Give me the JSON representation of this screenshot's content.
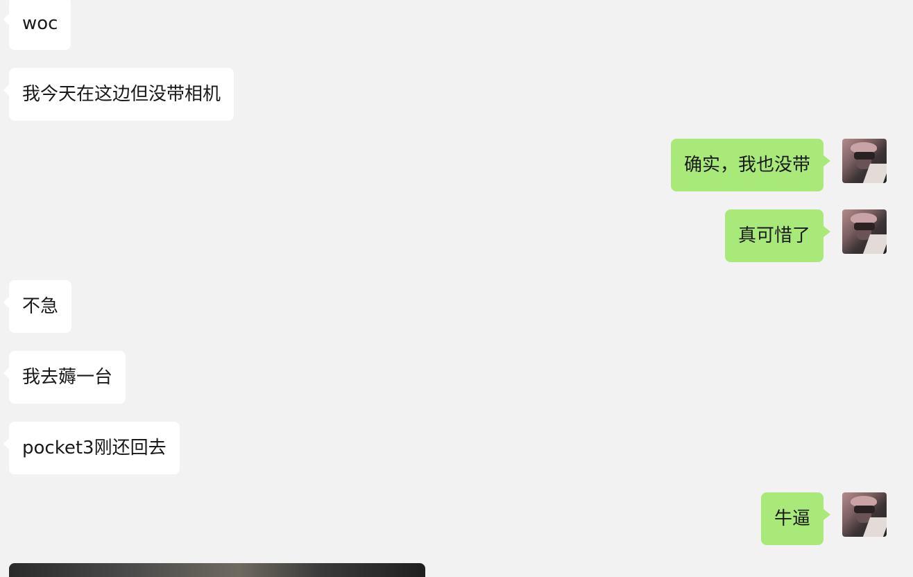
{
  "messages": [
    {
      "side": "in",
      "text": "woc"
    },
    {
      "side": "in",
      "text": "我今天在这边但没带相机"
    },
    {
      "side": "out",
      "text": "确实，我也没带"
    },
    {
      "side": "out",
      "text": "真可惜了"
    },
    {
      "side": "in",
      "text": "不急"
    },
    {
      "side": "in",
      "text": "我去薅一台"
    },
    {
      "side": "in",
      "text": "pocket3刚还回去"
    },
    {
      "side": "out",
      "text": "牛逼"
    }
  ],
  "colors": {
    "background": "#f2f2f2",
    "incoming_bubble": "#ffffff",
    "outgoing_bubble": "#a9e97a",
    "text": "#191919"
  },
  "icons": {
    "avatar": "user-avatar-illustration"
  }
}
